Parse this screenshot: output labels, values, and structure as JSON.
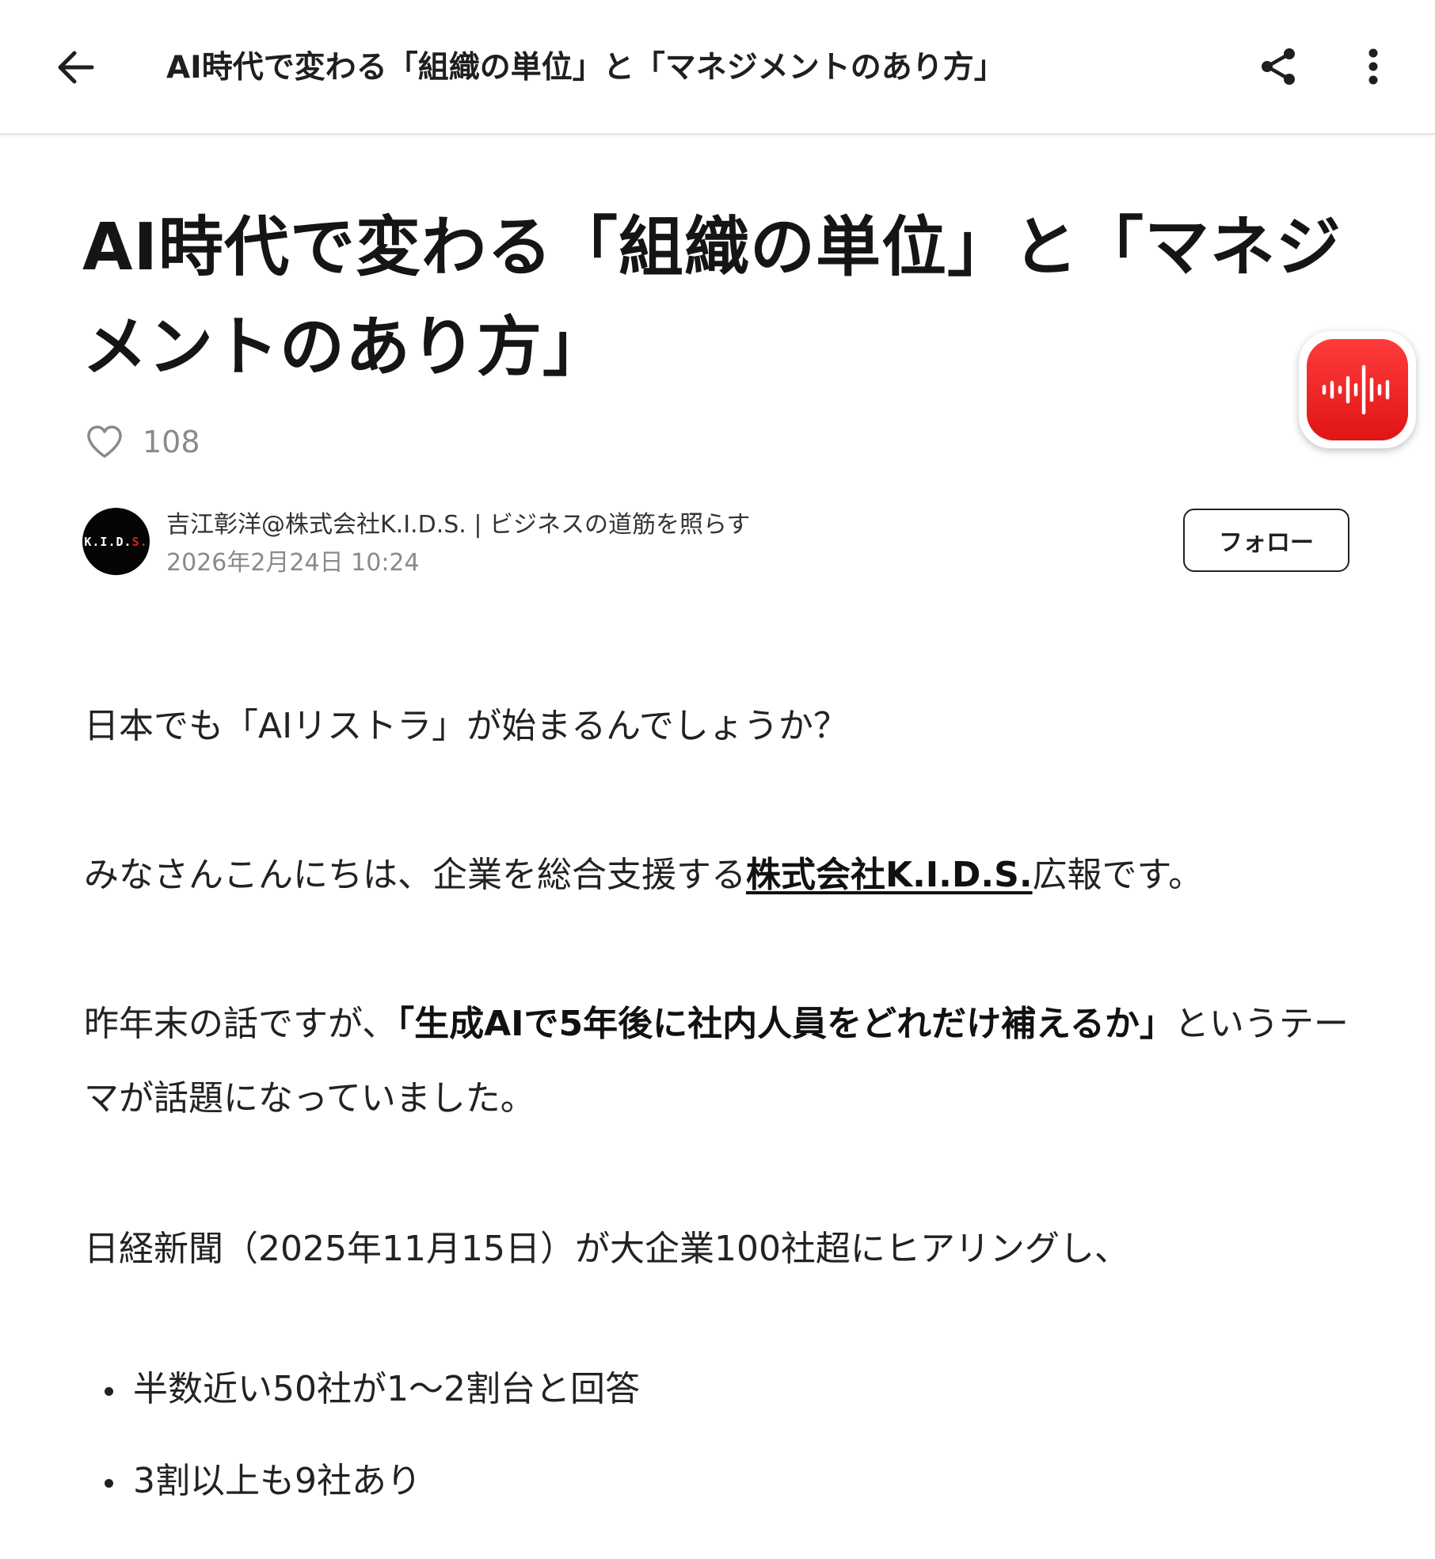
{
  "appbar": {
    "title": "AI時代で変わる「組織の単位」と「マネジメントのあり方」",
    "back_icon": "arrow-left-icon",
    "share_icon": "share-icon",
    "more_icon": "more-vertical-icon"
  },
  "article": {
    "title": "AI時代で変わる「組織の単位」と「マネジメントのあり方」",
    "like_icon": "heart-outline-icon",
    "like_count": "108",
    "author": {
      "name": "吉江彰洋@株式会社K.I.D.S. | ビジネスの道筋を照らす",
      "date": "2026年2月24日 10:24",
      "avatar_text_white": "K.I.D.",
      "avatar_text_red": "S."
    },
    "follow_label": "フォロー",
    "audio_icon": "audio-waveform-icon",
    "paragraphs": {
      "p1": "日本でも「AIリストラ」が始まるんでしょうか？",
      "p2_before": "みなさんこんにちは、企業を総合支援する",
      "p2_link": "株式会社K.I.D.S.",
      "p2_after": "広報です。",
      "p3_before": "昨年末の話ですが、",
      "p3_strong": "「生成AIで5年後に社内人員をどれだけ補えるか」",
      "p3_after": "というテーマが話題になっていました。",
      "p4": "日経新聞（2025年11月15日）が大企業100社超にヒアリングし、"
    },
    "bullets": [
      "半数近い50社が1〜2割台と回答",
      "3割以上も9社あり"
    ]
  },
  "colors": {
    "accent_red": "#e01515",
    "text_main": "#222222",
    "text_muted": "#8a8a8a"
  }
}
